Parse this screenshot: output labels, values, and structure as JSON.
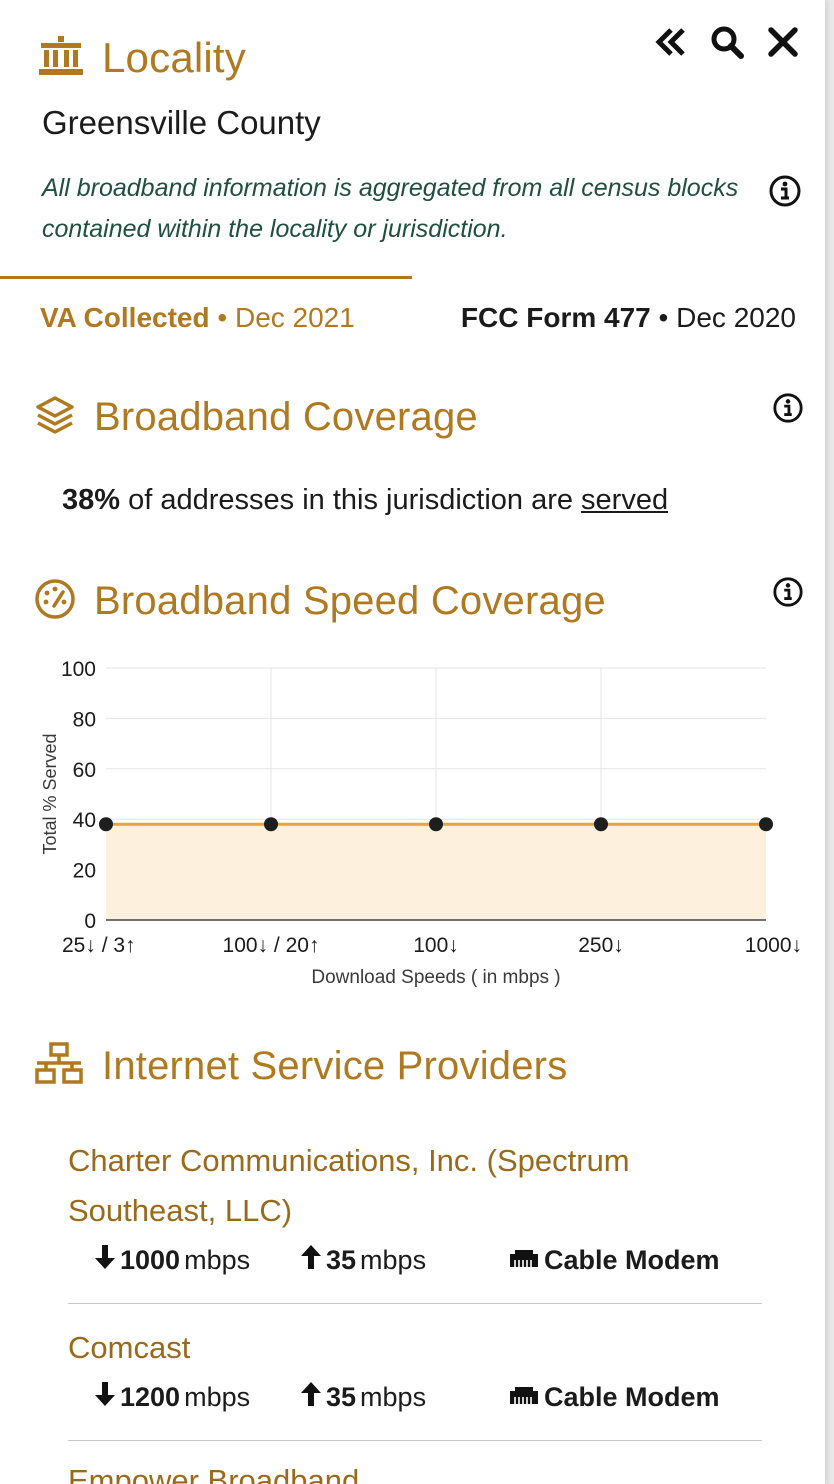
{
  "header": {
    "title": "Locality",
    "locality_name": "Greensville County",
    "note": "All broadband information is aggregated from all census blocks contained within the locality or jurisdiction."
  },
  "toolbar": {
    "icons": [
      "double-chevron-left-icon",
      "search-icon",
      "close-icon"
    ]
  },
  "source_tabs": {
    "va_label": "VA Collected",
    "va_date": "Dec 2021",
    "fcc_label": "FCC Form 477",
    "fcc_date": "Dec 2020",
    "separator": "•"
  },
  "coverage": {
    "title": "Broadband Coverage",
    "percent": "38%",
    "text_middle": " of addresses in this jurisdiction are ",
    "link": "served"
  },
  "speed_coverage": {
    "title": "Broadband Speed Coverage"
  },
  "chart_data": {
    "type": "area",
    "categories": [
      "25↓ / 3↑",
      "100↓ / 20↑",
      "100↓",
      "250↓",
      "1000↓"
    ],
    "series": [
      {
        "values": [
          38,
          38,
          38,
          38,
          38
        ]
      }
    ],
    "xlabel": "Download Speeds ( in mbps )",
    "ylabel": "Total % Served",
    "yticks": [
      0,
      20,
      40,
      60,
      80,
      100
    ],
    "ylim": [
      0,
      100
    ],
    "grid": true,
    "colors": {
      "line": "#e8a33a",
      "fill": "#fdf1dd",
      "point": "#1e1e1e"
    }
  },
  "providers_section": {
    "title": "Internet Service Providers",
    "providers": [
      {
        "name": "Charter Communications, Inc. (Spectrum Southeast, LLC)",
        "download": "1000",
        "upload": "35",
        "unit": "mbps",
        "technology": "Cable Modem"
      },
      {
        "name": "Comcast",
        "download": "1200",
        "upload": "35",
        "unit": "mbps",
        "technology": "Cable Modem"
      },
      {
        "name": "Empower Broadband"
      }
    ]
  },
  "colors": {
    "accent": "#b07920",
    "note_text": "#1f4f3f",
    "text": "#1b1b1b"
  }
}
